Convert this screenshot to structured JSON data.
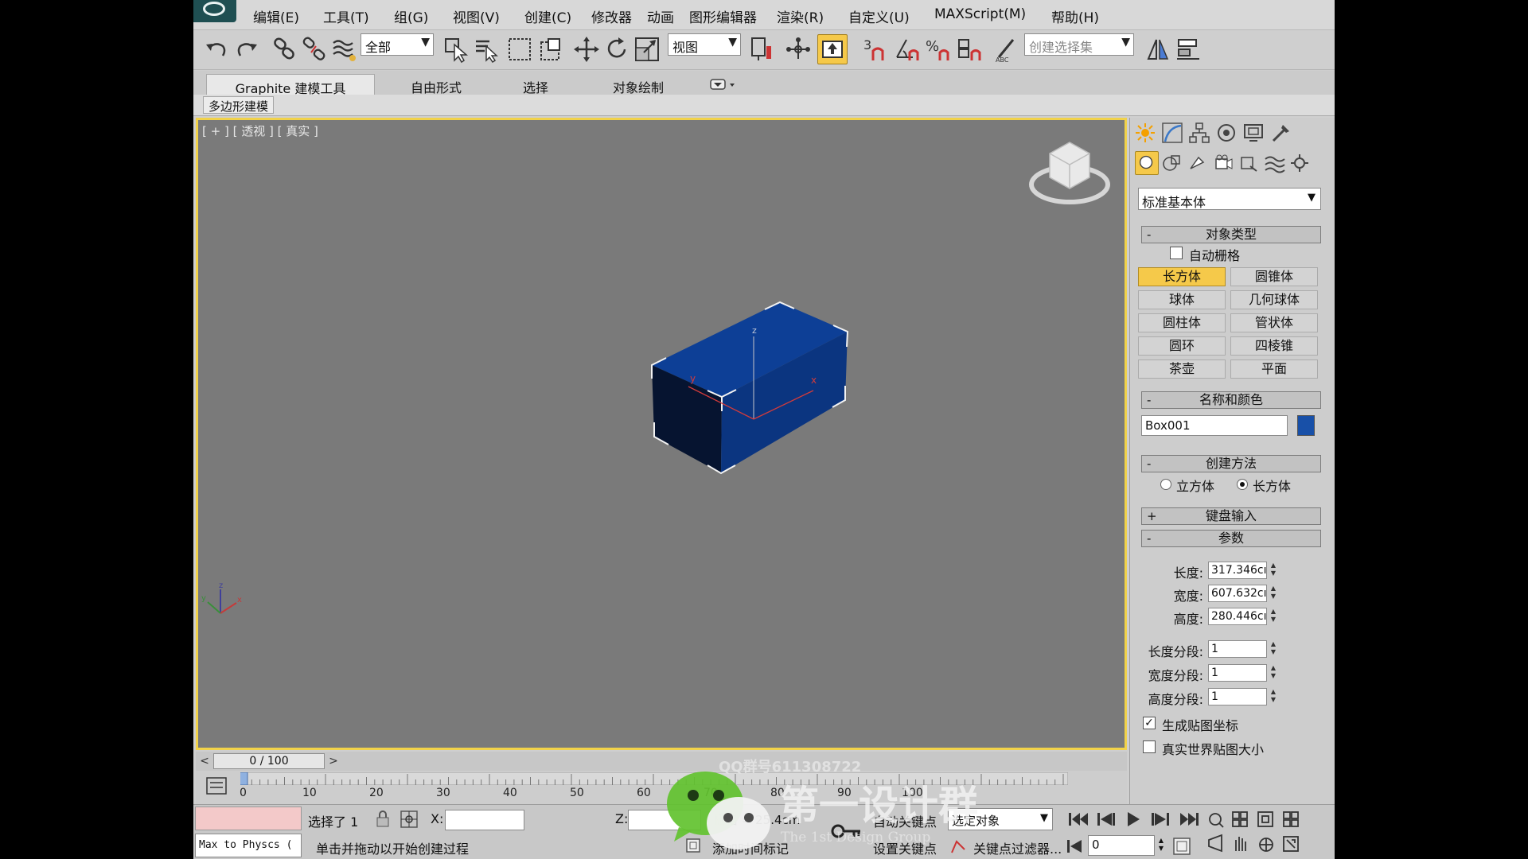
{
  "menu": {
    "items": [
      "编辑(E)",
      "工具(T)",
      "组(G)",
      "视图(V)",
      "创建(C)",
      "修改器",
      "动画",
      "图形编辑器",
      "渲染(R)",
      "自定义(U)",
      "MAXScript(M)",
      "帮助(H)"
    ]
  },
  "toolbar": {
    "selection_filter": "全部",
    "reference_coord": "视图",
    "named_selection_placeholder": "创建选择集",
    "snap_label": "3",
    "icons": [
      "undo-icon",
      "redo-icon",
      "link-icon",
      "unlink-icon",
      "bind-spacewarp-icon",
      "select-object-icon",
      "select-by-name-icon",
      "rect-region-icon",
      "window-crossing-icon",
      "move-icon",
      "rotate-icon",
      "scale-icon",
      "pivot-icon",
      "manipulate-icon",
      "snap-icon",
      "angle-snap-icon",
      "percent-snap-icon",
      "spinner-snap-icon",
      "edit-named-selection-icon",
      "mirror-icon",
      "align-icon"
    ]
  },
  "ribbon": {
    "tabs": [
      "Graphite 建模工具",
      "自由形式",
      "选择",
      "对象绘制"
    ],
    "sub_label": "多边形建模"
  },
  "viewport": {
    "label": "[ + ] [ 透视 ] [ 真实 ]",
    "object_color": "#0b3a8a",
    "border_color": "#f1d24a",
    "axis_labels": {
      "x": "x",
      "y": "y",
      "z": "z"
    }
  },
  "timeline": {
    "frame_display": "0 / 100",
    "tick_labels": [
      "0",
      "10",
      "20",
      "30",
      "40",
      "50",
      "60",
      "70",
      "80",
      "90",
      "100"
    ]
  },
  "status": {
    "selected_text": "选择了 1",
    "prompt": "单击并拖动以开始创建过程",
    "script_listener": "Max to Physcs (",
    "x_label": "X:",
    "z_label": "Z:",
    "grid": "栅格 = 25.4cm",
    "add_time_tag": "添加时间标记",
    "auto_key": "自动关键点",
    "set_key": "设置关键点",
    "key_mode": "选定对象",
    "key_filters": "关键点过滤器...",
    "current_frame": "0"
  },
  "panel": {
    "category": "标准基本体",
    "object_type_header": "对象类型",
    "autogrid": "自动栅格",
    "object_buttons": [
      "长方体",
      "圆锥体",
      "球体",
      "几何球体",
      "圆柱体",
      "管状体",
      "圆环",
      "四棱锥",
      "茶壶",
      "平面"
    ],
    "active_button": "长方体",
    "name_color_header": "名称和颜色",
    "object_name": "Box001",
    "object_color": "#1850a8",
    "creation_method_header": "创建方法",
    "creation_methods": [
      "立方体",
      "长方体"
    ],
    "creation_selected": 1,
    "keyboard_entry_header": "键盘输入",
    "params_header": "参数",
    "params": [
      {
        "label": "长度:",
        "value": "317.346cı"
      },
      {
        "label": "宽度:",
        "value": "607.632cı"
      },
      {
        "label": "高度:",
        "value": "280.446cı"
      }
    ],
    "segments": [
      {
        "label": "长度分段:",
        "value": "1"
      },
      {
        "label": "宽度分段:",
        "value": "1"
      },
      {
        "label": "高度分段:",
        "value": "1"
      }
    ],
    "gen_mapping": "生成贴图坐标",
    "gen_mapping_checked": true,
    "real_world": "真实世界贴图大小",
    "real_world_checked": false
  },
  "watermark": {
    "qq": "QQ群号611308722",
    "title": "第一设计群",
    "subtitle": "The 1st Design Group"
  }
}
